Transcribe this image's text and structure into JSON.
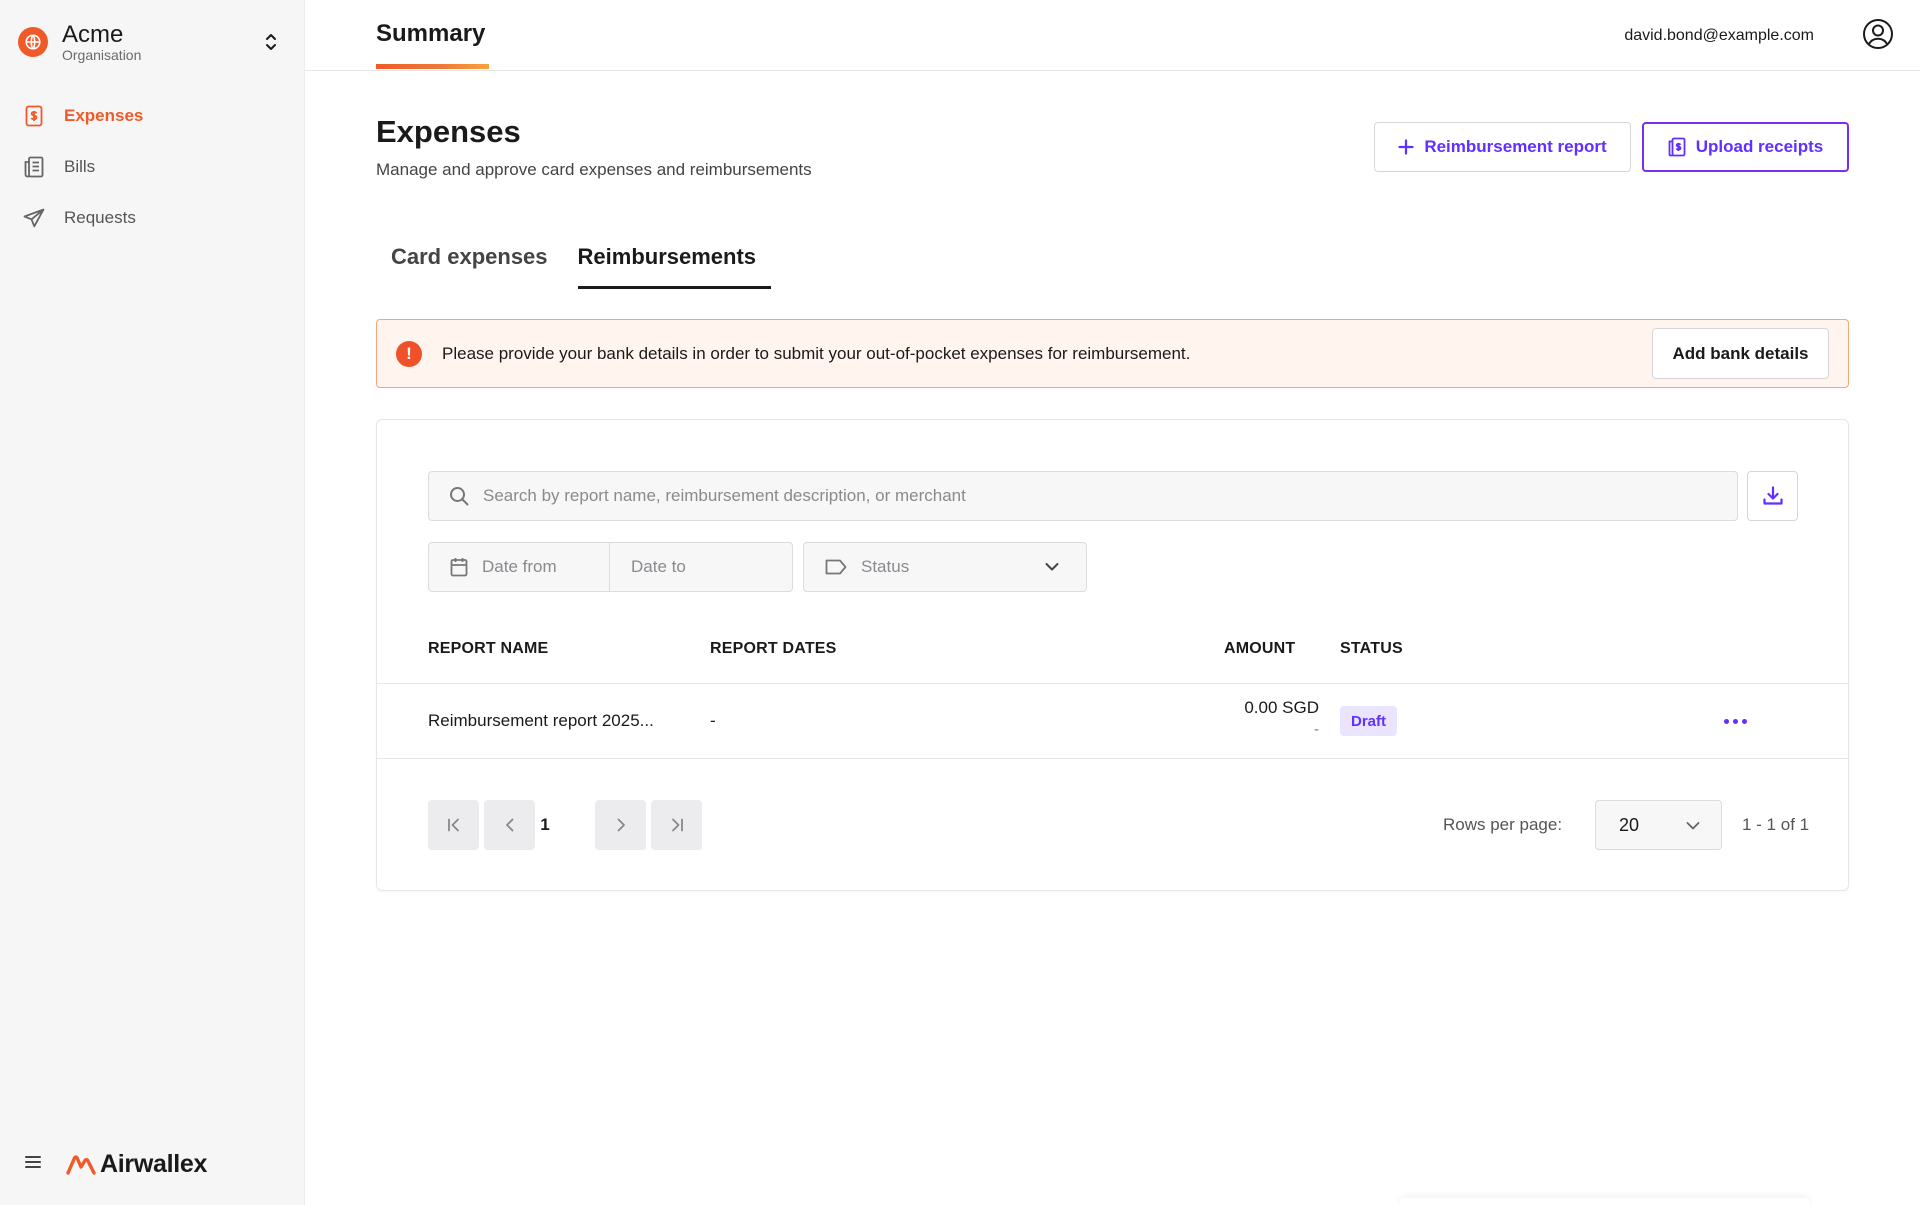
{
  "org": {
    "name": "Acme",
    "subtitle": "Organisation"
  },
  "sidebar": {
    "items": [
      {
        "label": "Expenses",
        "icon": "receipt-icon",
        "active": true
      },
      {
        "label": "Bills",
        "icon": "bill-icon",
        "active": false
      },
      {
        "label": "Requests",
        "icon": "paper-plane-icon",
        "active": false
      }
    ],
    "brand": "Airwallex"
  },
  "header": {
    "tab": "Summary",
    "user_email": "david.bond@example.com"
  },
  "page": {
    "title": "Expenses",
    "subtitle": "Manage and approve card expenses and reimbursements",
    "reimbursement_button": "Reimbursement report",
    "upload_button": "Upload receipts"
  },
  "tabs": [
    {
      "label": "Card expenses",
      "active": false
    },
    {
      "label": "Reimbursements",
      "active": true
    }
  ],
  "alert": {
    "message": "Please provide your bank details in order to submit your out-of-pocket expenses for reimbursement.",
    "button": "Add bank details"
  },
  "filters": {
    "search_placeholder": "Search by report name, reimbursement description, or merchant",
    "date_from": "Date from",
    "date_to": "Date to",
    "status": "Status"
  },
  "table": {
    "headers": {
      "report_name": "REPORT NAME",
      "report_dates": "REPORT DATES",
      "amount": "AMOUNT",
      "status": "STATUS"
    },
    "rows": [
      {
        "report_name": "Reimbursement report 2025...",
        "report_dates": "-",
        "amount": "0.00 SGD",
        "amount_sub": "-",
        "status": "Draft"
      }
    ]
  },
  "pagination": {
    "current_page": "1",
    "rows_label": "Rows per page:",
    "rows_per_page": "20",
    "range": "1 - 1 of 1"
  },
  "colors": {
    "brand_orange": "#f05a28",
    "accent_purple": "#612fff",
    "alert_bg": "#fff5ee"
  }
}
